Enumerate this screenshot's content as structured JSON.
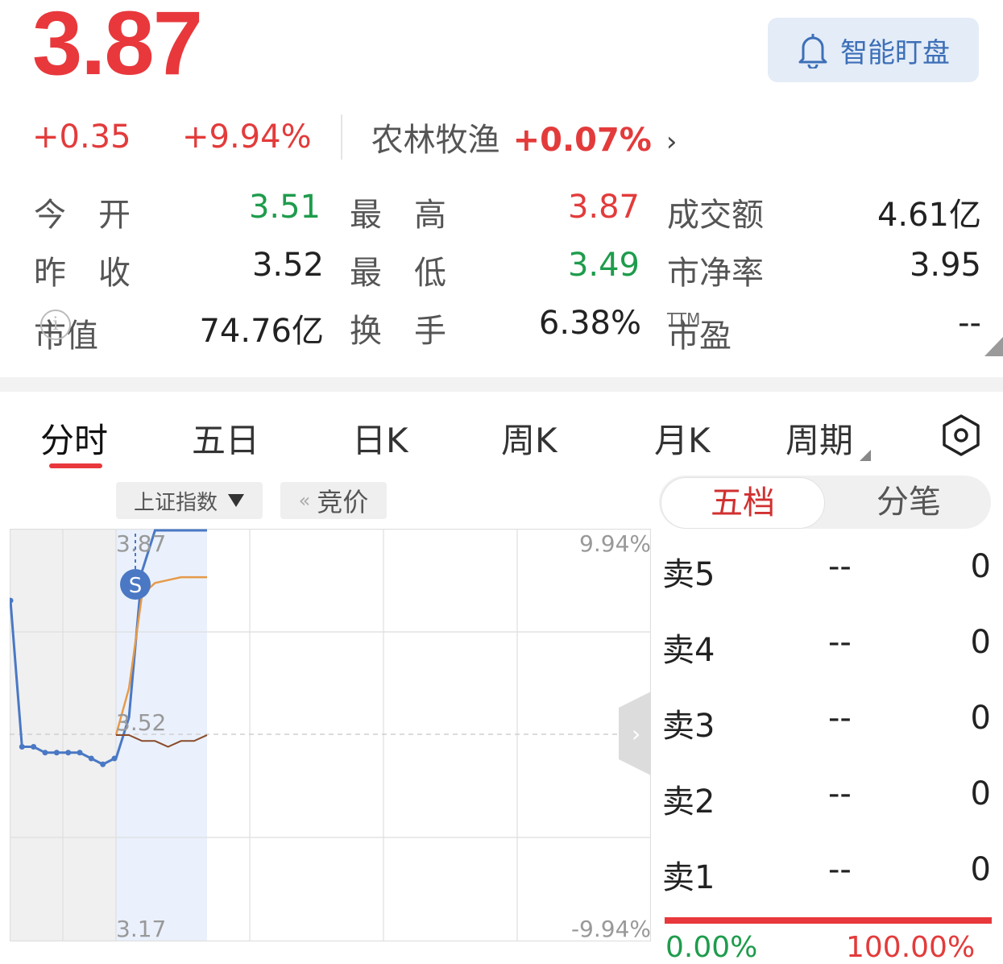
{
  "quote": {
    "price": "3.87",
    "change": "+0.35",
    "change_pct": "+9.94%",
    "sector_name": "农林牧渔",
    "sector_change": "+0.07%",
    "alert_button": "智能盯盘"
  },
  "stats": {
    "open_label": "今　开",
    "open_value": "3.51",
    "high_label": "最　高",
    "high_value": "3.87",
    "turnover_amount_label": "成交额",
    "turnover_amount_value": "4.61亿",
    "prev_close_label": "昨　收",
    "prev_close_value": "3.52",
    "low_label": "最　低",
    "low_value": "3.49",
    "pb_label": "市净率",
    "pb_value": "3.95",
    "market_cap_label": "市值",
    "market_cap_value": "74.76亿",
    "turnover_rate_label": "换　手",
    "turnover_rate_value": "6.38%",
    "pe_label": "市盈",
    "pe_sup": "TTM",
    "pe_value": "--"
  },
  "tabs": [
    "分时",
    "五日",
    "日K",
    "周K",
    "月K",
    "周期"
  ],
  "active_tab": "分时",
  "chart_controls": {
    "index_selector": "上证指数",
    "bid_button": "竞价"
  },
  "chart_data": {
    "type": "line",
    "prev_close": 3.52,
    "y_labels": {
      "top_price": "3.87",
      "mid_price": "3.52",
      "bottom_price": "3.17",
      "top_pct": "9.94%",
      "bottom_pct": "-9.94%"
    },
    "ylim": [
      3.17,
      3.87
    ],
    "marker_label": "S",
    "series": [
      {
        "role": "auction",
        "values": [
          3.75,
          3.5,
          3.5,
          3.49,
          3.49,
          3.49,
          3.49,
          3.48,
          3.47,
          3.48
        ]
      },
      {
        "role": "price",
        "values": [
          3.48,
          3.55,
          3.8,
          3.87,
          3.87,
          3.87,
          3.87,
          3.87
        ]
      },
      {
        "role": "average",
        "values": [
          3.52,
          3.6,
          3.76,
          3.78,
          3.785,
          3.79,
          3.79,
          3.79
        ]
      },
      {
        "role": "index",
        "values": [
          3.52,
          3.52,
          3.51,
          3.51,
          3.5,
          3.51,
          3.51,
          3.52
        ]
      }
    ],
    "grid": true
  },
  "order_book": {
    "tab_five": "五档",
    "tab_trades": "分笔",
    "rows": [
      {
        "label": "卖5",
        "price": "--",
        "volume": "0"
      },
      {
        "label": "卖4",
        "price": "--",
        "volume": "0"
      },
      {
        "label": "卖3",
        "price": "--",
        "volume": "0"
      },
      {
        "label": "卖2",
        "price": "--",
        "volume": "0"
      },
      {
        "label": "卖1",
        "price": "--",
        "volume": "0"
      }
    ],
    "buy_pct": "0.00%",
    "sell_pct": "100.00%"
  },
  "colors": {
    "up": "#e8383c",
    "down": "#1e9c4c",
    "accent": "#3c6fb8"
  }
}
